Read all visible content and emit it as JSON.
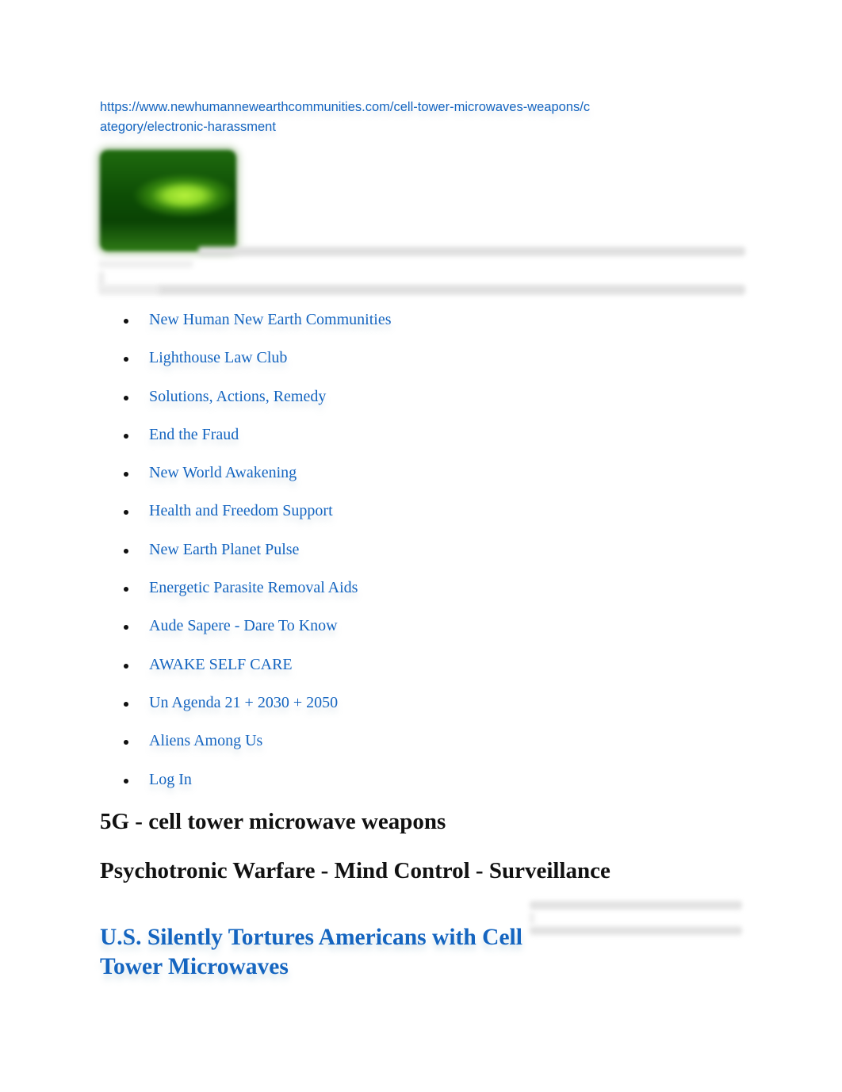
{
  "source_url": "https://www.newhumannewearthcommunities.com/cell-tower-microwaves-weapons/category/electronic-harassment",
  "logo": {
    "icon": "green-glow-logo-image"
  },
  "nav": {
    "items": [
      {
        "label": "New Human New Earth Communities"
      },
      {
        "label": "Lighthouse Law Club"
      },
      {
        "label": "Solutions, Actions, Remedy"
      },
      {
        "label": "End the Fraud"
      },
      {
        "label": "New World Awakening"
      },
      {
        "label": "Health and Freedom Support"
      },
      {
        "label": "New Earth Planet Pulse"
      },
      {
        "label": "Energetic Parasite Removal Aids"
      },
      {
        "label": "Aude Sapere - Dare To Know"
      },
      {
        "label": "AWAKE SELF CARE"
      },
      {
        "label": "Un Agenda 21 + 2030 + 2050"
      },
      {
        "label": "Aliens Among Us"
      },
      {
        "label": "Log In"
      }
    ]
  },
  "headings": {
    "category": "5G - cell tower microwave weapons",
    "subtitle": "Psychotronic Warfare - Mind Control - Surveillance"
  },
  "article": {
    "title": "U.S. Silently Tortures Americans with Cell Tower Microwaves"
  },
  "colors": {
    "link": "#1565c0",
    "heading": "#111111",
    "background": "#ffffff"
  }
}
